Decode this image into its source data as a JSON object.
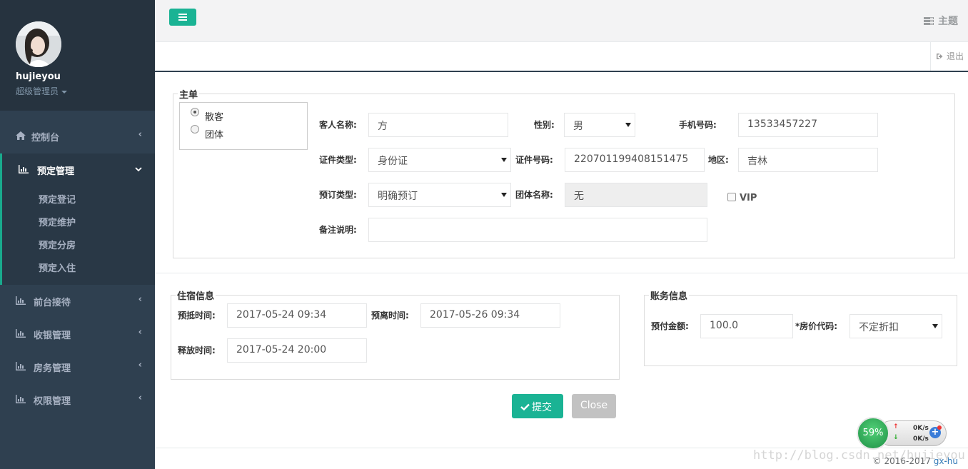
{
  "user": {
    "name": "hujieyou",
    "role": "超级管理员"
  },
  "nav": {
    "dashboard": "控制台",
    "booking": "预定管理",
    "booking_sub": [
      "预定登记",
      "预定维护",
      "预定分房",
      "预定入住"
    ],
    "front_desk": "前台接待",
    "cashier": "收银管理",
    "housekeeping": "房务管理",
    "permissions": "权限管理"
  },
  "header": {
    "theme": "主题",
    "logout": "退出"
  },
  "main_order": {
    "legend": "主单",
    "radio_individual": "散客",
    "radio_group": "团体",
    "guest_name_label": "客人名称:",
    "guest_name": "方",
    "gender_label": "性别:",
    "gender": "男",
    "phone_label": "手机号码:",
    "phone": "13533457227",
    "id_type_label": "证件类型:",
    "id_type": "身份证",
    "id_number_label": "证件号码:",
    "id_number": "220701199408151475",
    "region_label": "地区:",
    "region": "吉林",
    "booking_type_label": "预订类型:",
    "booking_type": "明确预订",
    "group_name_label": "团体名称:",
    "group_name": "无",
    "vip_label": "VIP",
    "remark_label": "备注说明:",
    "remark": ""
  },
  "stay_info": {
    "legend": "住宿信息",
    "arrival_label": "预抵时间:",
    "arrival": "2017-05-24 09:34",
    "departure_label": "预离时间:",
    "departure": "2017-05-26 09:34",
    "release_label": "释放时间:",
    "release": "2017-05-24 20:00"
  },
  "account_info": {
    "legend": "账务信息",
    "prepay_label": "预付金额:",
    "prepay": "100.0",
    "rate_code_label": "*房价代码:",
    "rate_code": "不定折扣"
  },
  "actions": {
    "submit": "提交",
    "close": "Close"
  },
  "footer": {
    "copyright": "© 2016-2017",
    "link": "gx-hu"
  },
  "watermark": "http://blog.csdn.net/hujieyou",
  "net_monitor": {
    "percent": "59%",
    "up": "0K/s",
    "down": "0K/s"
  },
  "colors": {
    "accent": "#1ab394",
    "sidebar": "#2f4050",
    "sidebar_dark": "#293846"
  }
}
